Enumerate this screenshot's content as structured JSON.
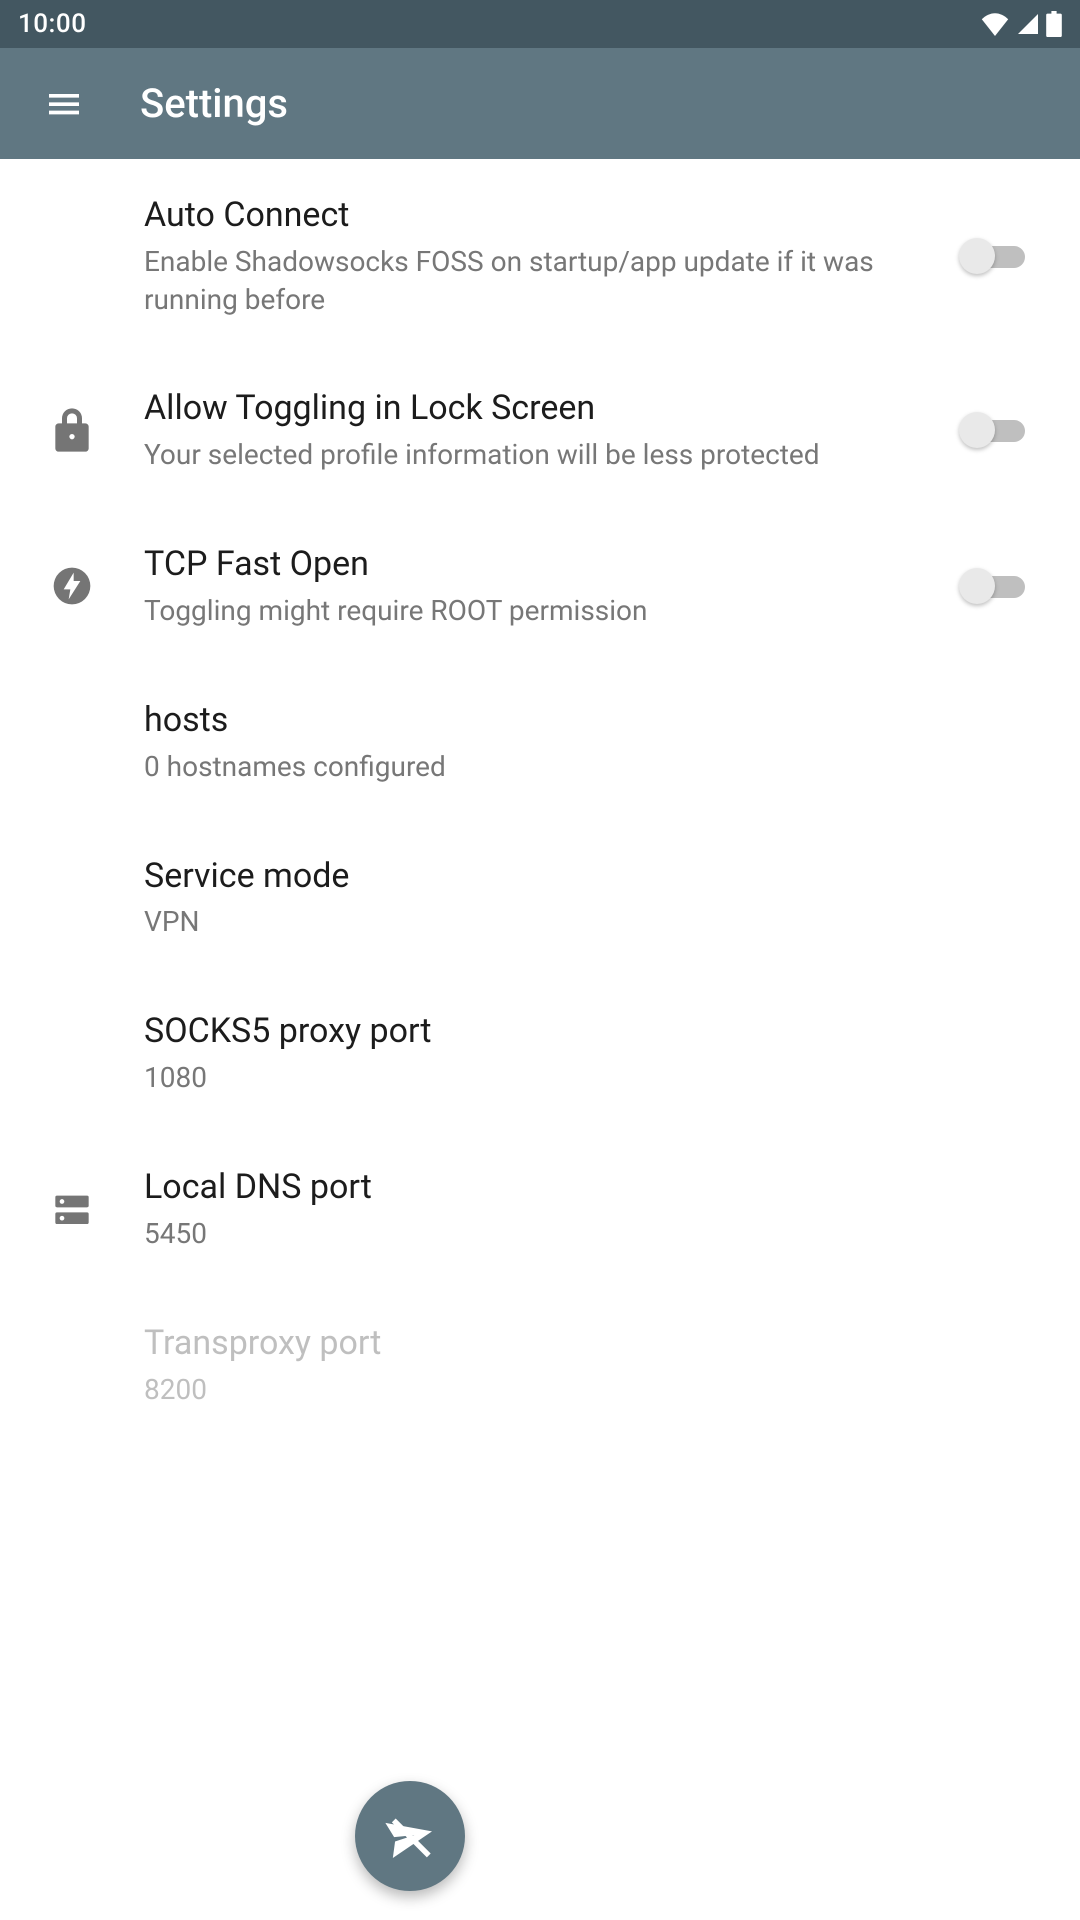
{
  "status": {
    "time": "10:00"
  },
  "appbar": {
    "title": "Settings"
  },
  "items": [
    {
      "title": "Auto Connect",
      "sub": "Enable Shadowsocks FOSS on startup/app update if it was running before"
    },
    {
      "title": "Allow Toggling in Lock Screen",
      "sub": "Your selected profile information will be less protected"
    },
    {
      "title": "TCP Fast Open",
      "sub": "Toggling might require ROOT permission"
    },
    {
      "title": "hosts",
      "sub": "0 hostnames configured"
    },
    {
      "title": "Service mode",
      "sub": "VPN"
    },
    {
      "title": "SOCKS5 proxy port",
      "sub": "1080"
    },
    {
      "title": "Local DNS port",
      "sub": "5450"
    },
    {
      "title": "Transproxy port",
      "sub": "8200"
    }
  ]
}
